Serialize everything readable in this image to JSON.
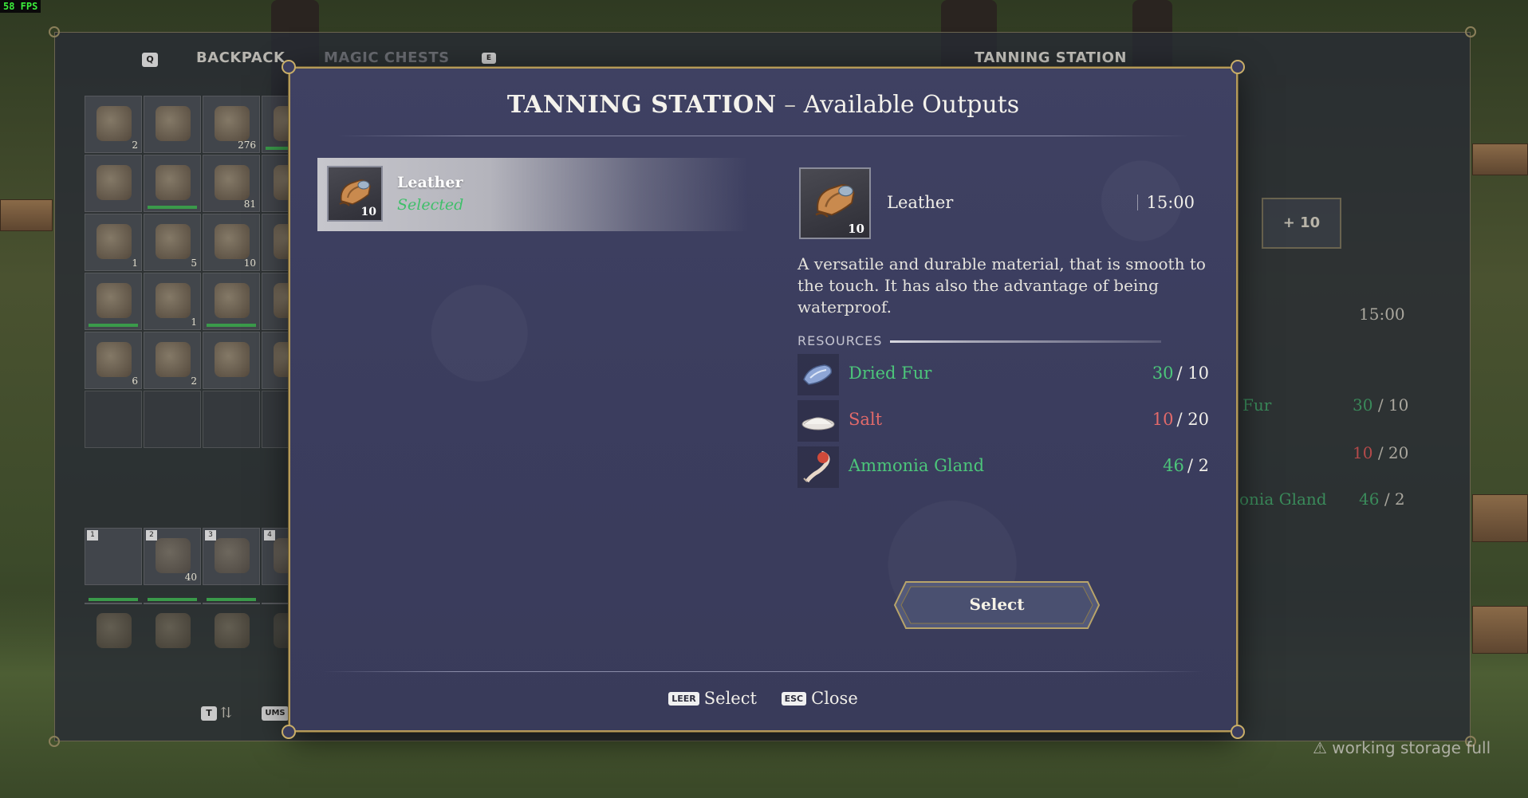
{
  "hud": {
    "fps": "58 FPS"
  },
  "inventory": {
    "key_prev": "Q",
    "tab_backpack": "BACKPACK",
    "tab_magic_chests": "MAGIC CHESTS",
    "key_next": "E",
    "slots": [
      {
        "count": "2",
        "bar": false
      },
      {
        "count": "",
        "bar": false
      },
      {
        "count": "276",
        "bar": false
      },
      {
        "count": "",
        "bar": true
      },
      {
        "count": "",
        "bar": false
      },
      {
        "count": "",
        "bar": true
      },
      {
        "count": "81",
        "bar": false
      },
      {
        "count": "",
        "bar": false
      },
      {
        "count": "1",
        "bar": false
      },
      {
        "count": "5",
        "bar": false
      },
      {
        "count": "10",
        "bar": false
      },
      {
        "count": "",
        "bar": false
      },
      {
        "count": "",
        "bar": true
      },
      {
        "count": "1",
        "bar": false
      },
      {
        "count": "",
        "bar": true
      },
      {
        "count": "",
        "bar": false
      },
      {
        "count": "6",
        "bar": false
      },
      {
        "count": "2",
        "bar": false
      },
      {
        "count": "",
        "bar": false
      },
      {
        "count": "",
        "bar": false
      }
    ],
    "hotbar_keys": [
      "1",
      "2",
      "3",
      "4"
    ],
    "hotbar_counts": [
      "",
      "40",
      "",
      ""
    ],
    "sort_key": "T",
    "transfer_key": "UMS"
  },
  "station_panel": {
    "title": "TANNING STATION",
    "bonus_button": "+ 10",
    "time": "15:00",
    "rows": [
      {
        "name": "Fur",
        "have": "30",
        "need": "/ 10"
      },
      {
        "name": "",
        "have": "10",
        "need": "/ 20"
      },
      {
        "name": "onia Gland",
        "have": "46",
        "need": "/ 2"
      }
    ],
    "warning": "working storage full"
  },
  "modal": {
    "title_strong": "TANNING STATION",
    "title_sep": " – ",
    "title_rest": "Available Outputs",
    "list": [
      {
        "name": "Leather",
        "state": "Selected",
        "qty": "10"
      }
    ],
    "detail": {
      "name": "Leather",
      "qty": "10",
      "time": "15:00",
      "description": "A versatile and durable material, that is smooth to the touch. It has also the advantage of being waterproof.",
      "resources_label": "RESOURCES",
      "resources": [
        {
          "name": "Dried Fur",
          "have": "30",
          "need": "/ 10",
          "status": "ok",
          "icon": "dried-fur-icon"
        },
        {
          "name": "Salt",
          "have": "10",
          "need": "/ 20",
          "status": "insufficient",
          "icon": "salt-icon"
        },
        {
          "name": "Ammonia Gland",
          "have": "46",
          "need": "/ 2",
          "status": "ok",
          "icon": "ammonia-gland-icon"
        }
      ]
    },
    "select_button": "Select",
    "footer": {
      "select_key": "LEER",
      "select_label": "Select",
      "close_key": "ESC",
      "close_label": "Close"
    }
  },
  "colors": {
    "modal_bg": "#3d3f60",
    "frame_gold": "#b49a5a",
    "ok_green": "#4cc67a",
    "bad_red": "#e26a6a"
  }
}
